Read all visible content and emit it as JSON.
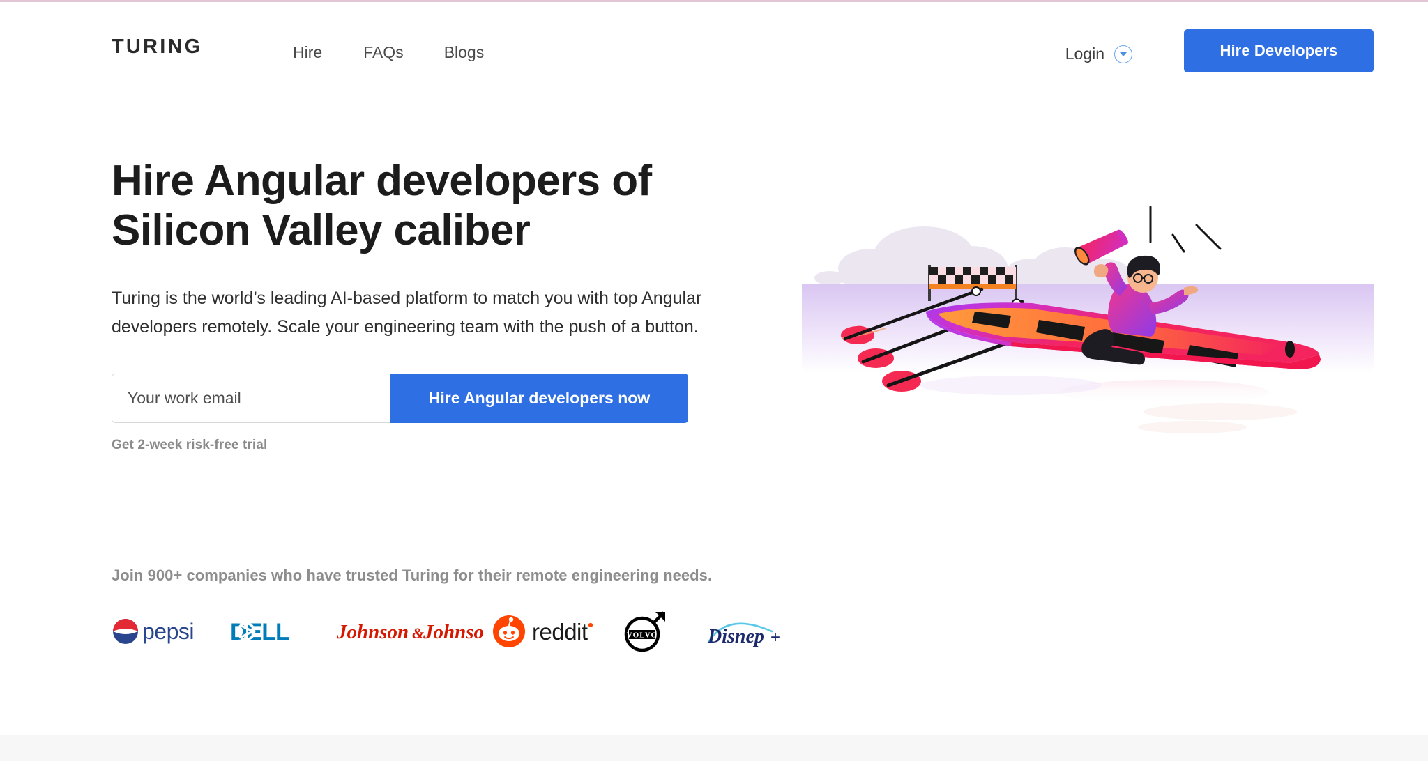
{
  "brand": {
    "name": "TURING"
  },
  "nav": {
    "items": [
      {
        "label": "Hire",
        "name": "nav-item-hire"
      },
      {
        "label": "FAQs",
        "name": "nav-item-faqs"
      },
      {
        "label": "Blogs",
        "name": "nav-item-blogs"
      }
    ]
  },
  "header": {
    "login_label": "Login",
    "login_caret_icon": "chevron-down-circle-icon",
    "cta_label": "Hire Developers",
    "cta_color": "#2f6fe4"
  },
  "hero": {
    "headline": "Hire Angular developers of Silicon Valley caliber",
    "subcopy": "Turing is the world’s leading AI-based platform to match you with top Angular developers remotely. Scale your engineering team with the push of a button.",
    "form": {
      "email_placeholder": "Your work email",
      "email_value": "",
      "submit_label": "Hire Angular developers now",
      "note": "Get 2-week risk-free trial"
    }
  },
  "social_proof": {
    "text": "Join 900+ companies who have trusted Turing for their remote engineering needs.",
    "logos": [
      {
        "name": "pepsi-logo",
        "label": "pepsi",
        "color": "#28458E"
      },
      {
        "name": "dell-logo",
        "label": "DELL",
        "color": "#007DB8"
      },
      {
        "name": "jnj-logo",
        "label": "Johnson & Johnson",
        "color": "#D51900"
      },
      {
        "name": "reddit-logo",
        "label": "reddit",
        "color": "#FF4500"
      },
      {
        "name": "volvo-logo",
        "label": "VOLVO",
        "color": "#000000"
      },
      {
        "name": "disney-logo",
        "label": "Disney+",
        "color": "#1B2A6B"
      }
    ]
  },
  "illustration": {
    "name": "rowing-boat-illustration",
    "alt": "Rower in a racing boat with megaphone crossing a checkered finish line",
    "colors": {
      "boat_pink": "#F4245E",
      "boat_magenta": "#D12FC2",
      "boat_purple": "#9B3CF0",
      "interior_orange": "#FF8A3D",
      "oar_blade": "#F42A52",
      "cloud": "#ECE6F1",
      "water": "#E6D7F7",
      "flag_orange": "#F58220",
      "shirt_pink": "#F0368E"
    }
  },
  "theme": {
    "accent": "#2f6fe4",
    "top_hairline": "#e3c6d4",
    "bottom_band": "#f7f7f8"
  }
}
